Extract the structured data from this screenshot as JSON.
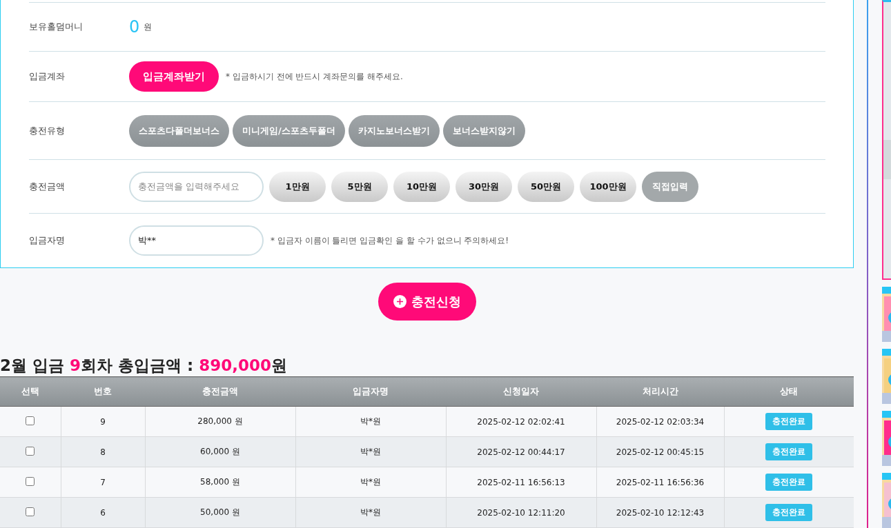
{
  "form": {
    "rows": [
      {
        "kind": "money",
        "label": "보유홀덤머니",
        "value": "0",
        "unit": "원"
      },
      {
        "kind": "account",
        "label": "입금계좌",
        "button": "입금계좌받기",
        "note": "* 입금하시기 전에 반드시 계좌문의를 해주세요."
      },
      {
        "kind": "types",
        "label": "충전유형",
        "options": [
          "스포츠다폴더보너스",
          "미니게임/스포츠두폴더",
          "카지노보너스받기",
          "보너스받지않기"
        ]
      },
      {
        "kind": "amount",
        "label": "충전금액",
        "placeholder": "충전금액을 입력해주세요",
        "buttons": [
          {
            "label": "1만원",
            "kind": "preset"
          },
          {
            "label": "5만원",
            "kind": "preset"
          },
          {
            "label": "10만원",
            "kind": "preset"
          },
          {
            "label": "30만원",
            "kind": "preset"
          },
          {
            "label": "50만원",
            "kind": "preset"
          },
          {
            "label": "100만원",
            "kind": "preset"
          },
          {
            "label": "직접입력",
            "kind": "custom"
          }
        ]
      },
      {
        "kind": "name",
        "label": "입금자명",
        "value": "박**",
        "note": "* 입금자 이름이 틀리면 입금확인 을 할 수가 없으니 주의하세요!"
      }
    ]
  },
  "submit": {
    "label": "충전신청"
  },
  "summary": "2월 입금 **9**회차 총입금액 : **890,000**원",
  "table": {
    "columns": [
      "선택",
      "번호",
      "충전금액",
      "입금자명",
      "신청일자",
      "처리시간",
      "상태"
    ],
    "rows": [
      {
        "cells": [
          {
            "kind": "checkbox",
            "checked": false
          },
          {
            "kind": "text",
            "text": "9"
          },
          {
            "kind": "text",
            "text": "280,000 원"
          },
          {
            "kind": "text",
            "text": "박*원"
          },
          {
            "kind": "text",
            "text": "2025-02-12 02:02:41"
          },
          {
            "kind": "text",
            "text": "2025-02-12 02:03:34"
          },
          {
            "kind": "status",
            "text": "충전완료"
          }
        ]
      },
      {
        "cells": [
          {
            "kind": "checkbox",
            "checked": false
          },
          {
            "kind": "text",
            "text": "8"
          },
          {
            "kind": "text",
            "text": "60,000 원"
          },
          {
            "kind": "text",
            "text": "박*원"
          },
          {
            "kind": "text",
            "text": "2025-02-12 00:44:17"
          },
          {
            "kind": "text",
            "text": "2025-02-12 00:45:15"
          },
          {
            "kind": "status",
            "text": "충전완료"
          }
        ]
      },
      {
        "cells": [
          {
            "kind": "checkbox",
            "checked": false
          },
          {
            "kind": "text",
            "text": "7"
          },
          {
            "kind": "text",
            "text": "58,000 원"
          },
          {
            "kind": "text",
            "text": "박*원"
          },
          {
            "kind": "text",
            "text": "2025-02-11 16:56:13"
          },
          {
            "kind": "text",
            "text": "2025-02-11 16:56:36"
          },
          {
            "kind": "status",
            "text": "충전완료"
          }
        ]
      },
      {
        "cells": [
          {
            "kind": "checkbox",
            "checked": false
          },
          {
            "kind": "text",
            "text": "6"
          },
          {
            "kind": "text",
            "text": "50,000 원"
          },
          {
            "kind": "text",
            "text": "박*원"
          },
          {
            "kind": "text",
            "text": "2025-02-10 12:11:20"
          },
          {
            "kind": "text",
            "text": "2025-02-10 12:12:43"
          },
          {
            "kind": "status",
            "text": "충전완료"
          }
        ]
      }
    ]
  }
}
